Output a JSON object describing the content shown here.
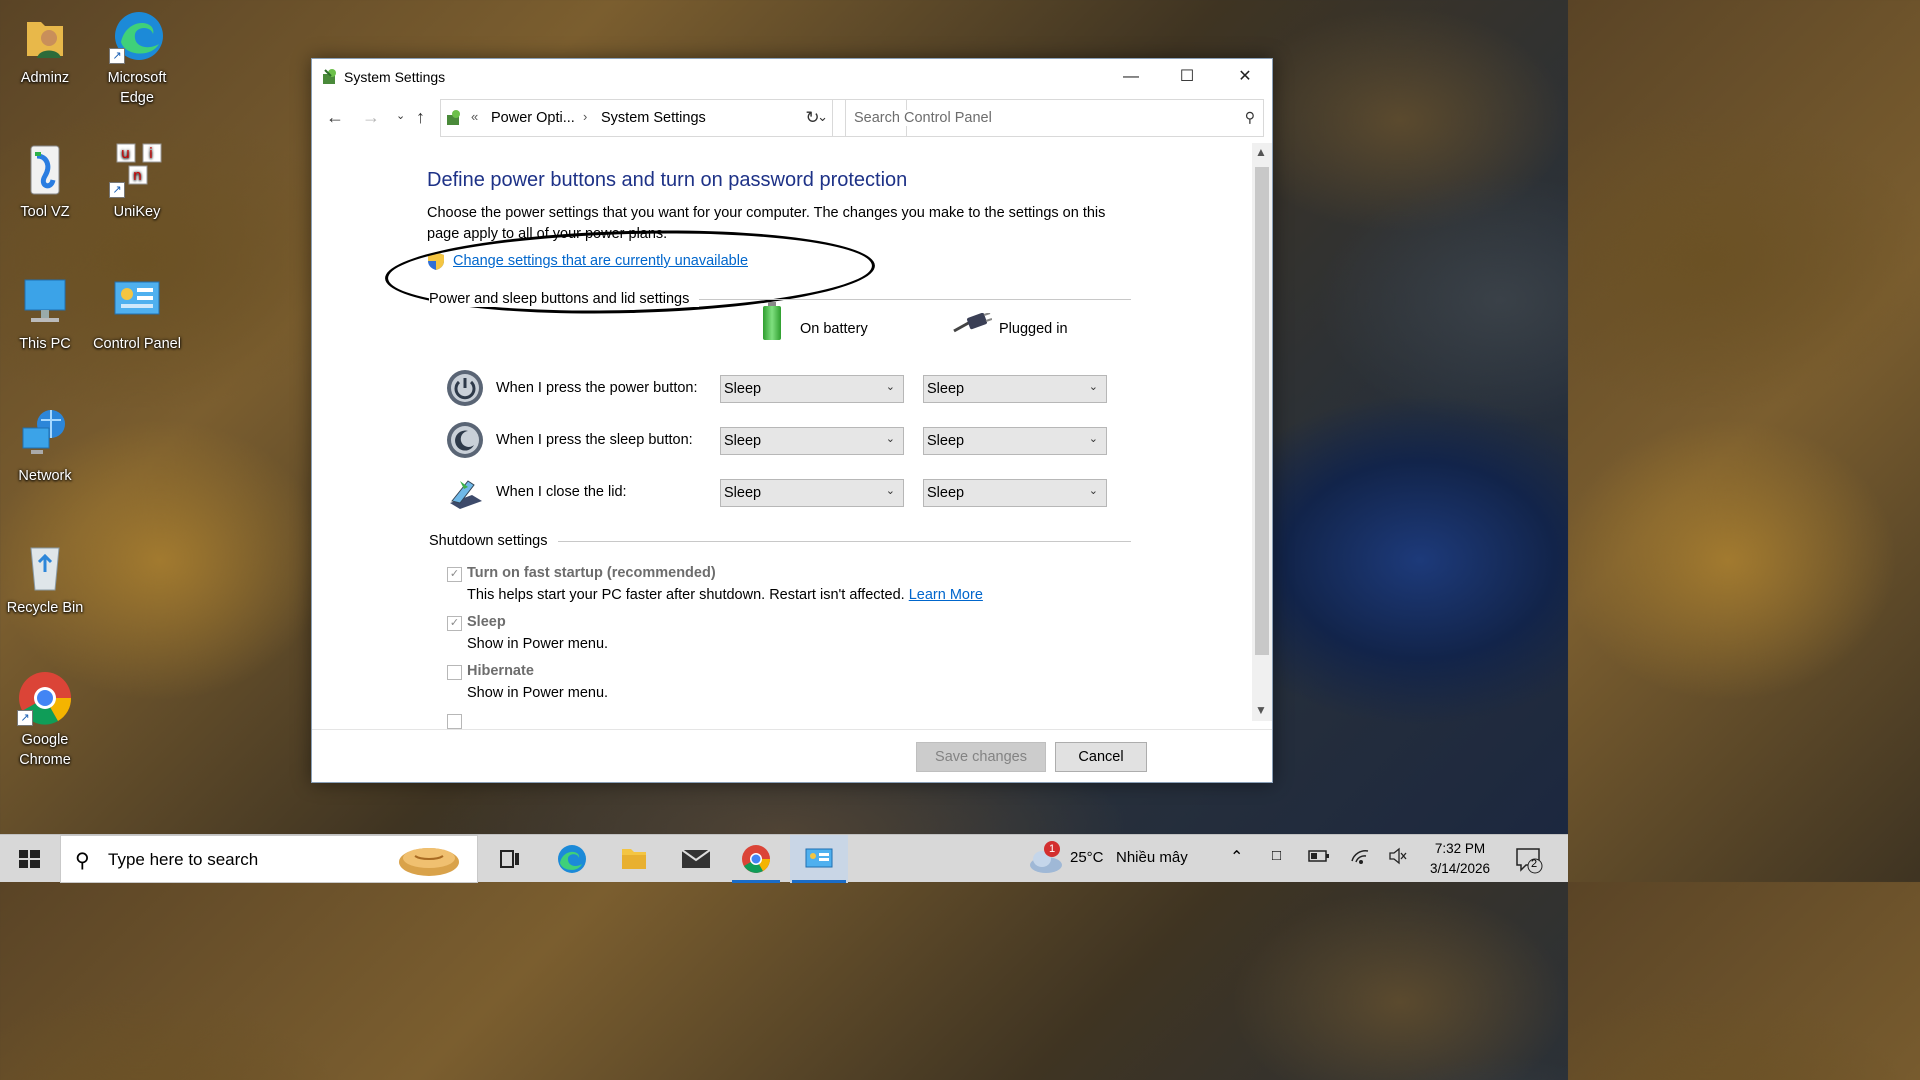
{
  "desktop": {
    "icons": [
      {
        "label": "Adminz"
      },
      {
        "label": "Microsoft Edge"
      },
      {
        "label": "Tool VZ"
      },
      {
        "label": "UniKey"
      },
      {
        "label": "This PC"
      },
      {
        "label": "Control Panel"
      },
      {
        "label": "Network"
      },
      {
        "label": "Recycle Bin"
      },
      {
        "label": "Google Chrome"
      }
    ]
  },
  "window": {
    "title": "System Settings",
    "address": {
      "sep": "«",
      "crumb1": "Power Opti...",
      "crumb2": "System Settings"
    },
    "search_placeholder": "Search Control Panel",
    "heading": "Define power buttons and turn on password protection",
    "description": "Choose the power settings that you want for your computer. The changes you make to the settings on this page apply to all of your power plans.",
    "change_link": "Change settings that are currently unavailable",
    "power_group_label": "Power and sleep buttons and lid settings",
    "col_battery": "On battery",
    "col_plugged": "Plugged in",
    "rows": [
      {
        "label": "When I press the power button:",
        "battery": "Sleep",
        "plugged": "Sleep"
      },
      {
        "label": "When I press the sleep button:",
        "battery": "Sleep",
        "plugged": "Sleep"
      },
      {
        "label": "When I close the lid:",
        "battery": "Sleep",
        "plugged": "Sleep"
      }
    ],
    "shutdown_group_label": "Shutdown settings",
    "shutdown": [
      {
        "title": "Turn on fast startup (recommended)",
        "desc": "This helps start your PC faster after shutdown. Restart isn't affected.",
        "link": "Learn More",
        "checked": true
      },
      {
        "title": "Sleep",
        "desc": "Show in Power menu.",
        "checked": true
      },
      {
        "title": "Hibernate",
        "desc": "Show in Power menu.",
        "checked": false
      }
    ],
    "save_label": "Save changes",
    "cancel_label": "Cancel"
  },
  "taskbar": {
    "search_placeholder": "Type here to search",
    "weather_temp": "25°C",
    "weather_desc": "Nhiều mây",
    "weather_badge": "1",
    "time": "7:32 PM",
    "date": "3/14/2026",
    "notification_count": "2"
  },
  "colors": {
    "heading": "#1e3287",
    "link": "#0066cc",
    "accent": "#1a6cc7"
  }
}
